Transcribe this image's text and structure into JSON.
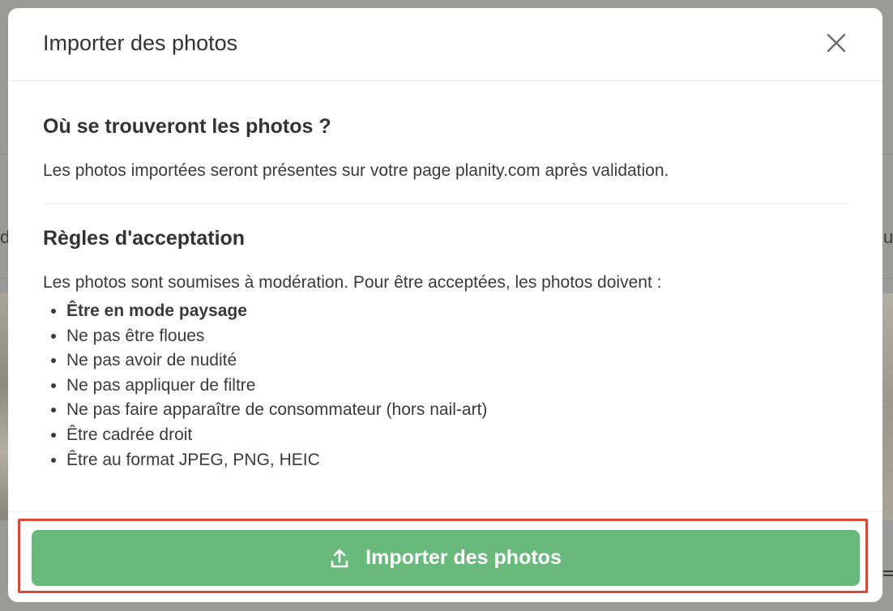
{
  "background": {
    "left_text": "d",
    "right_text": "u"
  },
  "modal": {
    "title": "Importer des photos",
    "close_icon": "close-icon"
  },
  "location_section": {
    "title": "Où se trouveront les photos ?",
    "text": "Les photos importées seront présentes sur votre page planity.com après validation."
  },
  "rules_section": {
    "title": "Règles d'acceptation",
    "intro": "Les photos sont soumises à modération. Pour être acceptées, les photos doivent :",
    "rules": [
      "Être en mode paysage",
      "Ne pas être floues",
      "Ne pas avoir de nudité",
      "Ne pas appliquer de filtre",
      "Ne pas faire apparaître de consommateur (hors nail-art)",
      "Être cadrée droit",
      "Être au format JPEG, PNG, HEIC"
    ]
  },
  "footer": {
    "import_button_label": "Importer des photos",
    "import_button_icon": "upload-icon"
  },
  "colors": {
    "accent_green": "#69b97d",
    "highlight_red": "#d94a36",
    "text_dark": "#333333"
  }
}
